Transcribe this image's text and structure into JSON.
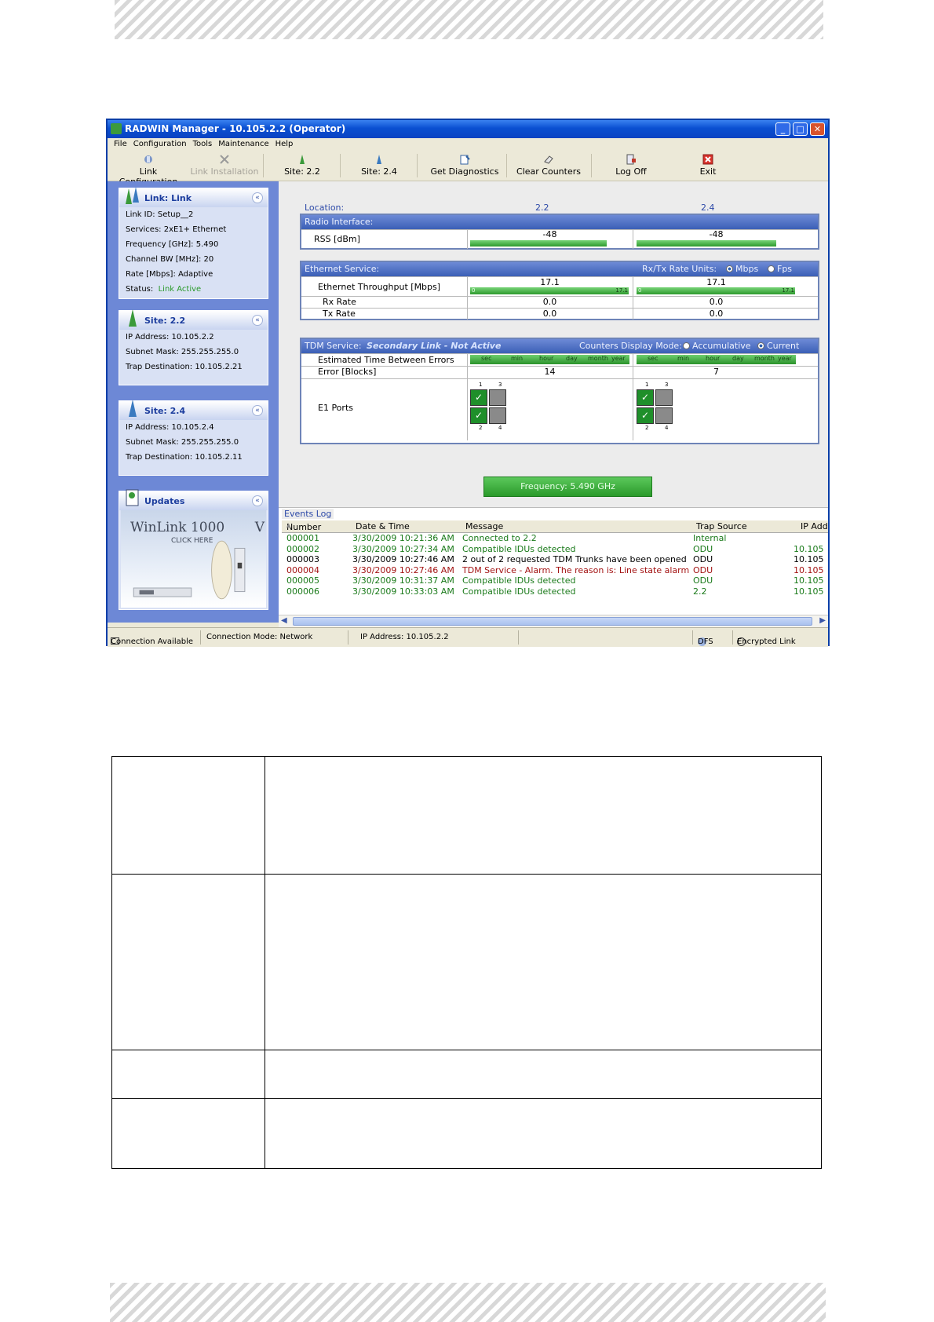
{
  "window": {
    "title": "RADWIN Manager - 10.105.2.2 (Operator)",
    "controls": {
      "minimize": "_",
      "maximize": "□",
      "close": "✕"
    }
  },
  "menu": [
    "File",
    "Configuration",
    "Tools",
    "Maintenance",
    "Help"
  ],
  "toolbar": [
    {
      "label": "Link Configuration",
      "icon": "link-config-icon",
      "enabled": true
    },
    {
      "label": "Link Installation",
      "icon": "link-installation-icon",
      "enabled": false
    },
    {
      "label": "Site: 2.2",
      "icon": "site-icon",
      "enabled": true
    },
    {
      "label": "Site: 2.4",
      "icon": "site-icon",
      "enabled": true
    },
    {
      "label": "Get Diagnostics",
      "icon": "diagnostics-icon",
      "enabled": true
    },
    {
      "label": "Clear Counters",
      "icon": "eraser-icon",
      "enabled": true
    },
    {
      "label": "Log Off",
      "icon": "log-off-icon",
      "enabled": true
    },
    {
      "label": "Exit",
      "icon": "exit-icon",
      "enabled": true
    }
  ],
  "link_panel": {
    "title": "Link: Link",
    "chevron": "«",
    "rows": [
      "Link ID:   Setup__2",
      "Services:   2xE1+ Ethernet",
      "Frequency [GHz]:   5.490",
      "Channel BW [MHz]:   20",
      "Rate [Mbps]:   Adaptive"
    ],
    "status_label": "Status:",
    "status_value": "Link Active"
  },
  "site22_panel": {
    "title": "Site: 2.2",
    "rows": [
      "IP Address:  10.105.2.2",
      "Subnet Mask:  255.255.255.0",
      "Trap Destination:  10.105.2.21"
    ]
  },
  "site24_panel": {
    "title": "Site: 2.4",
    "rows": [
      "IP Address:  10.105.2.4",
      "Subnet Mask:  255.255.255.0",
      "Trap Destination:  10.105.2.11"
    ]
  },
  "updates_panel": {
    "title": "Updates",
    "banner_title": "WinLink 1000",
    "banner_sub": "CLICK HERE",
    "banner_tail": "V"
  },
  "main": {
    "location_label": "Location:",
    "site_a": "2.2",
    "site_b": "2.4",
    "radio": {
      "title": "Radio Interface:",
      "rss_label": "RSS [dBm]",
      "rss_a": "-48",
      "rss_b": "-48"
    },
    "ethernet": {
      "title": "Ethernet Service:",
      "units_label": "Rx/Tx Rate Units:",
      "unit_mbps": "Mbps",
      "unit_fps": "Fps",
      "throughput_label": "Ethernet Throughput [Mbps]",
      "throughput_a": "17.1",
      "throughput_b": "17.1",
      "scale_min": "0",
      "scale_max": "17.1",
      "rx_label": "Rx Rate",
      "tx_label": "Tx Rate",
      "rx_a": "0.0",
      "rx_b": "0.0",
      "tx_a": "0.0",
      "tx_b": "0.0"
    },
    "tdm": {
      "title": "TDM Service:",
      "status": "Secondary Link - Not Active",
      "counters_label": "Counters Display Mode:",
      "mode_accum": "Accumulative",
      "mode_current": "Current",
      "etbe_label": "Estimated Time Between Errors",
      "scale": [
        "sec",
        "min",
        "hour",
        "day",
        "month",
        "year"
      ],
      "error_label": "Error [Blocks]",
      "error_a": "14",
      "error_b": "7",
      "e1_label": "E1 Ports",
      "port_nums": [
        "1",
        "3",
        "2",
        "4"
      ]
    },
    "frequency_button": "Frequency: 5.490 GHz"
  },
  "events": {
    "title": "Events Log",
    "columns": [
      "Number",
      "Date & Time",
      "Message",
      "Trap Source",
      "IP Add"
    ],
    "sort_arrow": "▲",
    "rows": [
      {
        "num": "000001",
        "time": "3/30/2009 10:21:36 AM",
        "msg": "Connected to 2.2",
        "src": "Internal",
        "ip": "",
        "color": "#1a7a1a"
      },
      {
        "num": "000002",
        "time": "3/30/2009 10:27:34 AM",
        "msg": "Compatible IDUs detected",
        "src": "ODU",
        "ip": "10.105",
        "color": "#1a7a1a"
      },
      {
        "num": "000003",
        "time": "3/30/2009 10:27:46 AM",
        "msg": "2 out of 2 requested TDM Trunks have been opened",
        "src": "ODU",
        "ip": "10.105",
        "color": "#000000"
      },
      {
        "num": "000004",
        "time": "3/30/2009 10:27:46 AM",
        "msg": "TDM Service - Alarm. The reason is: Line state alarm",
        "src": "ODU",
        "ip": "10.105",
        "color": "#a31313"
      },
      {
        "num": "000005",
        "time": "3/30/2009 10:31:37 AM",
        "msg": "Compatible IDUs detected",
        "src": "ODU",
        "ip": "10.105",
        "color": "#1a7a1a"
      },
      {
        "num": "000006",
        "time": "3/30/2009 10:33:03 AM",
        "msg": "Compatible IDUs detected",
        "src": "2.2",
        "ip": "10.105",
        "color": "#1a7a1a"
      }
    ]
  },
  "statusbar": {
    "connection": "Connection Available",
    "mode": "Connection Mode: Network",
    "ip": "IP Address: 10.105.2.2",
    "dfs": "DFS",
    "encrypted": "Encrypted Link"
  },
  "colors": {
    "accent": "#2f9a2f",
    "title_blue": "#0a4fd1",
    "pane_blue": "#6d88d6"
  }
}
